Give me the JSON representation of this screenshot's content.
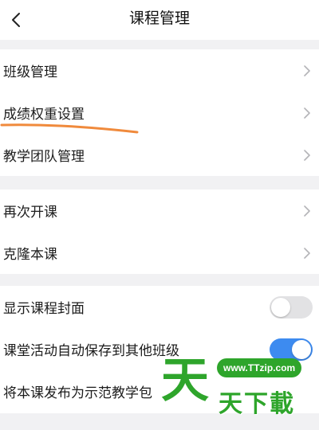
{
  "header": {
    "title": "课程管理",
    "back_icon": "chevron-left-icon"
  },
  "groups": [
    {
      "rows": [
        {
          "label": "班级管理",
          "accessory": "chevron-right-icon"
        },
        {
          "label": "成绩权重设置",
          "accessory": "chevron-right-icon"
        },
        {
          "label": "教学团队管理",
          "accessory": "chevron-right-icon"
        }
      ]
    },
    {
      "rows": [
        {
          "label": "再次开课",
          "accessory": "chevron-right-icon"
        },
        {
          "label": "克隆本课",
          "accessory": "chevron-right-icon"
        }
      ]
    },
    {
      "rows": [
        {
          "label": "显示课程封面",
          "toggle": false
        },
        {
          "label": "课堂活动自动保存到其他班级",
          "toggle": true
        },
        {
          "label": "将本课发布为示范教学包"
        }
      ]
    }
  ],
  "annotation": {
    "color": "#f08a3c"
  },
  "watermark": {
    "big_char": "天",
    "url": "www.TTzip.com",
    "text": "天下載",
    "color": "#2ea52b"
  },
  "colors": {
    "toggle_on": "#3d8bf0",
    "toggle_off": "#e2e2e4",
    "background": "#f1f1f3"
  }
}
